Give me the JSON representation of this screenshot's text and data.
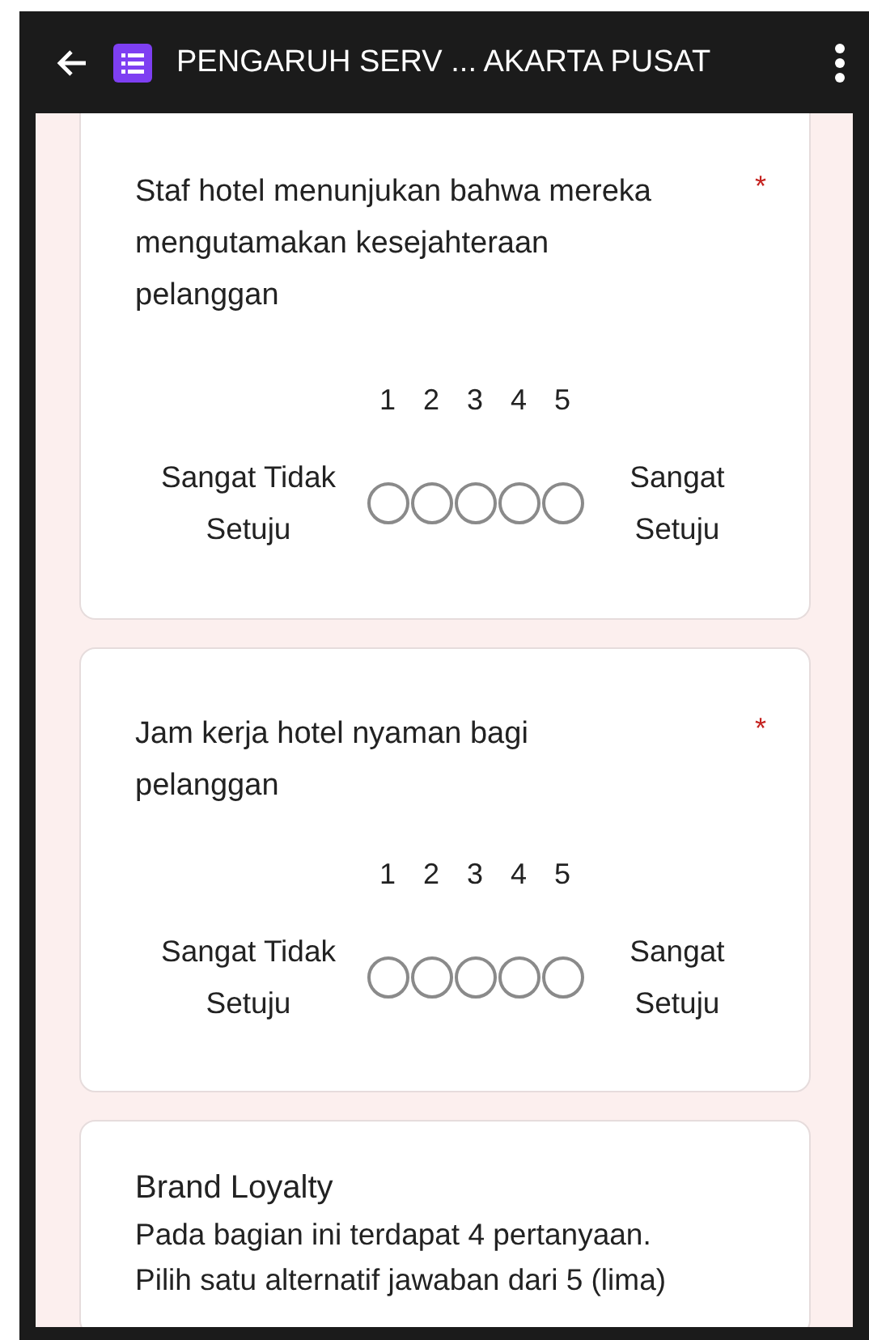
{
  "header": {
    "title": "PENGARUH SERV ... AKARTA PUSAT"
  },
  "questions": [
    {
      "title": "Staf hotel menunjukan bahwa mereka mengutamakan kesejahteraan pelanggan",
      "required": true,
      "required_mark": "*",
      "low_label": "Sangat Tidak Setuju",
      "high_label": "Sangat Setuju",
      "options": [
        {
          "label": "1",
          "selected": false
        },
        {
          "label": "2",
          "selected": false
        },
        {
          "label": "3",
          "selected": false
        },
        {
          "label": "4",
          "selected": false
        },
        {
          "label": "5",
          "selected": false
        }
      ]
    },
    {
      "title": "Jam kerja hotel nyaman bagi pelanggan",
      "required": true,
      "required_mark": "*",
      "low_label": "Sangat Tidak Setuju",
      "high_label": "Sangat Setuju",
      "options": [
        {
          "label": "1",
          "selected": false
        },
        {
          "label": "2",
          "selected": false
        },
        {
          "label": "3",
          "selected": false
        },
        {
          "label": "4",
          "selected": false
        },
        {
          "label": "5",
          "selected": false
        }
      ]
    }
  ],
  "section": {
    "title": "Brand Loyalty",
    "description": [
      "Pada bagian ini terdapat 4 pertanyaan.",
      "Pilih satu alternatif jawaban dari 5 (lima)"
    ]
  }
}
